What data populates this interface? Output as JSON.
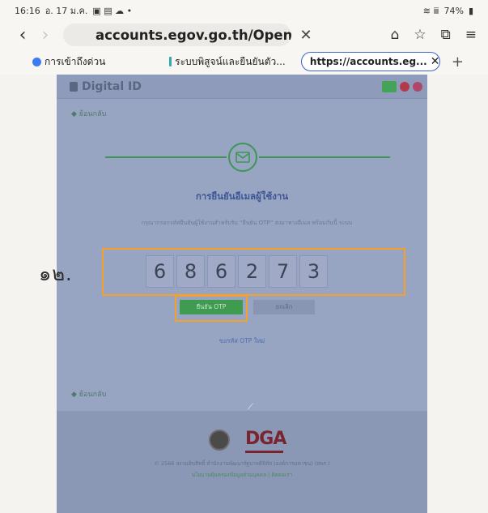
{
  "status": {
    "time": "16:16",
    "date": "อ. 17 ม.ค.",
    "notif_icons": "▣ ▤ ☁ •",
    "signal": "≋ ⅲ",
    "battery": "74%"
  },
  "browser": {
    "address": "accounts.egov.go.th/OpenId/Man",
    "tabs": [
      {
        "label": "การเข้าถึงด่วน"
      },
      {
        "label": "ระบบพิสูจน์และยืนยันตัว..."
      },
      {
        "label": "https://accounts.eg..."
      }
    ],
    "icons": [
      "back-icon",
      "forward-icon",
      "close-icon",
      "home-icon",
      "star-icon",
      "tabs-icon",
      "menu-icon"
    ]
  },
  "page": {
    "logo_text": "Digital ID",
    "back_link": "ย้อนกลับ",
    "title": "การยืนยันอีเมลผู้ใช้งาน",
    "description": "กรุณากรอกรหัสยืนยันผู้ใช้งานสำหรับรับ “ยืนยัน OTP” ส่งมาทางอีเมล\nพร้อมกันนี้ ระบบ",
    "annotation": "๑๒.",
    "otp_digits": [
      "6",
      "8",
      "6",
      "2",
      "7",
      "3"
    ],
    "confirm_label": "ยืนยัน OTP",
    "cancel_label": "ยกเลิก",
    "resend_label": "ขอรหัส OTP ใหม่",
    "footer": {
      "dga_text": "DGA",
      "copyright": "© 2566 สงวนลิขสิทธิ์ สำนักงานพัฒนารัฐบาลดิจิทัล (องค์การมหาชน) (สพร.)",
      "links": "นโยบายคุ้มครองข้อมูลส่วนบุคคล | ติดต่อเรา"
    }
  },
  "colors": {
    "accent_green": "#3e9b50",
    "highlight_orange": "#f5a028",
    "title_blue": "#3d5592",
    "dga_red": "#7a2430"
  }
}
